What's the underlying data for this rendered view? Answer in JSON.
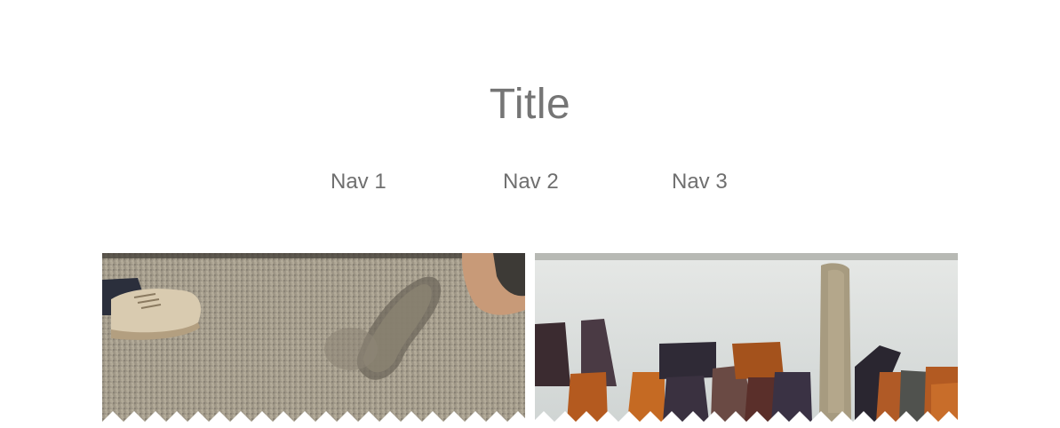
{
  "header": {
    "title": "Title"
  },
  "nav": {
    "items": [
      {
        "label": "Nav 1"
      },
      {
        "label": "Nav 2"
      },
      {
        "label": "Nav 3"
      }
    ]
  },
  "gallery": {
    "images": [
      {
        "subject": "sand-footprint-photo"
      },
      {
        "subject": "boots-row-photo"
      }
    ]
  },
  "colors": {
    "title_text": "#757575",
    "nav_text": "#6f6f6f",
    "background": "#ffffff"
  }
}
